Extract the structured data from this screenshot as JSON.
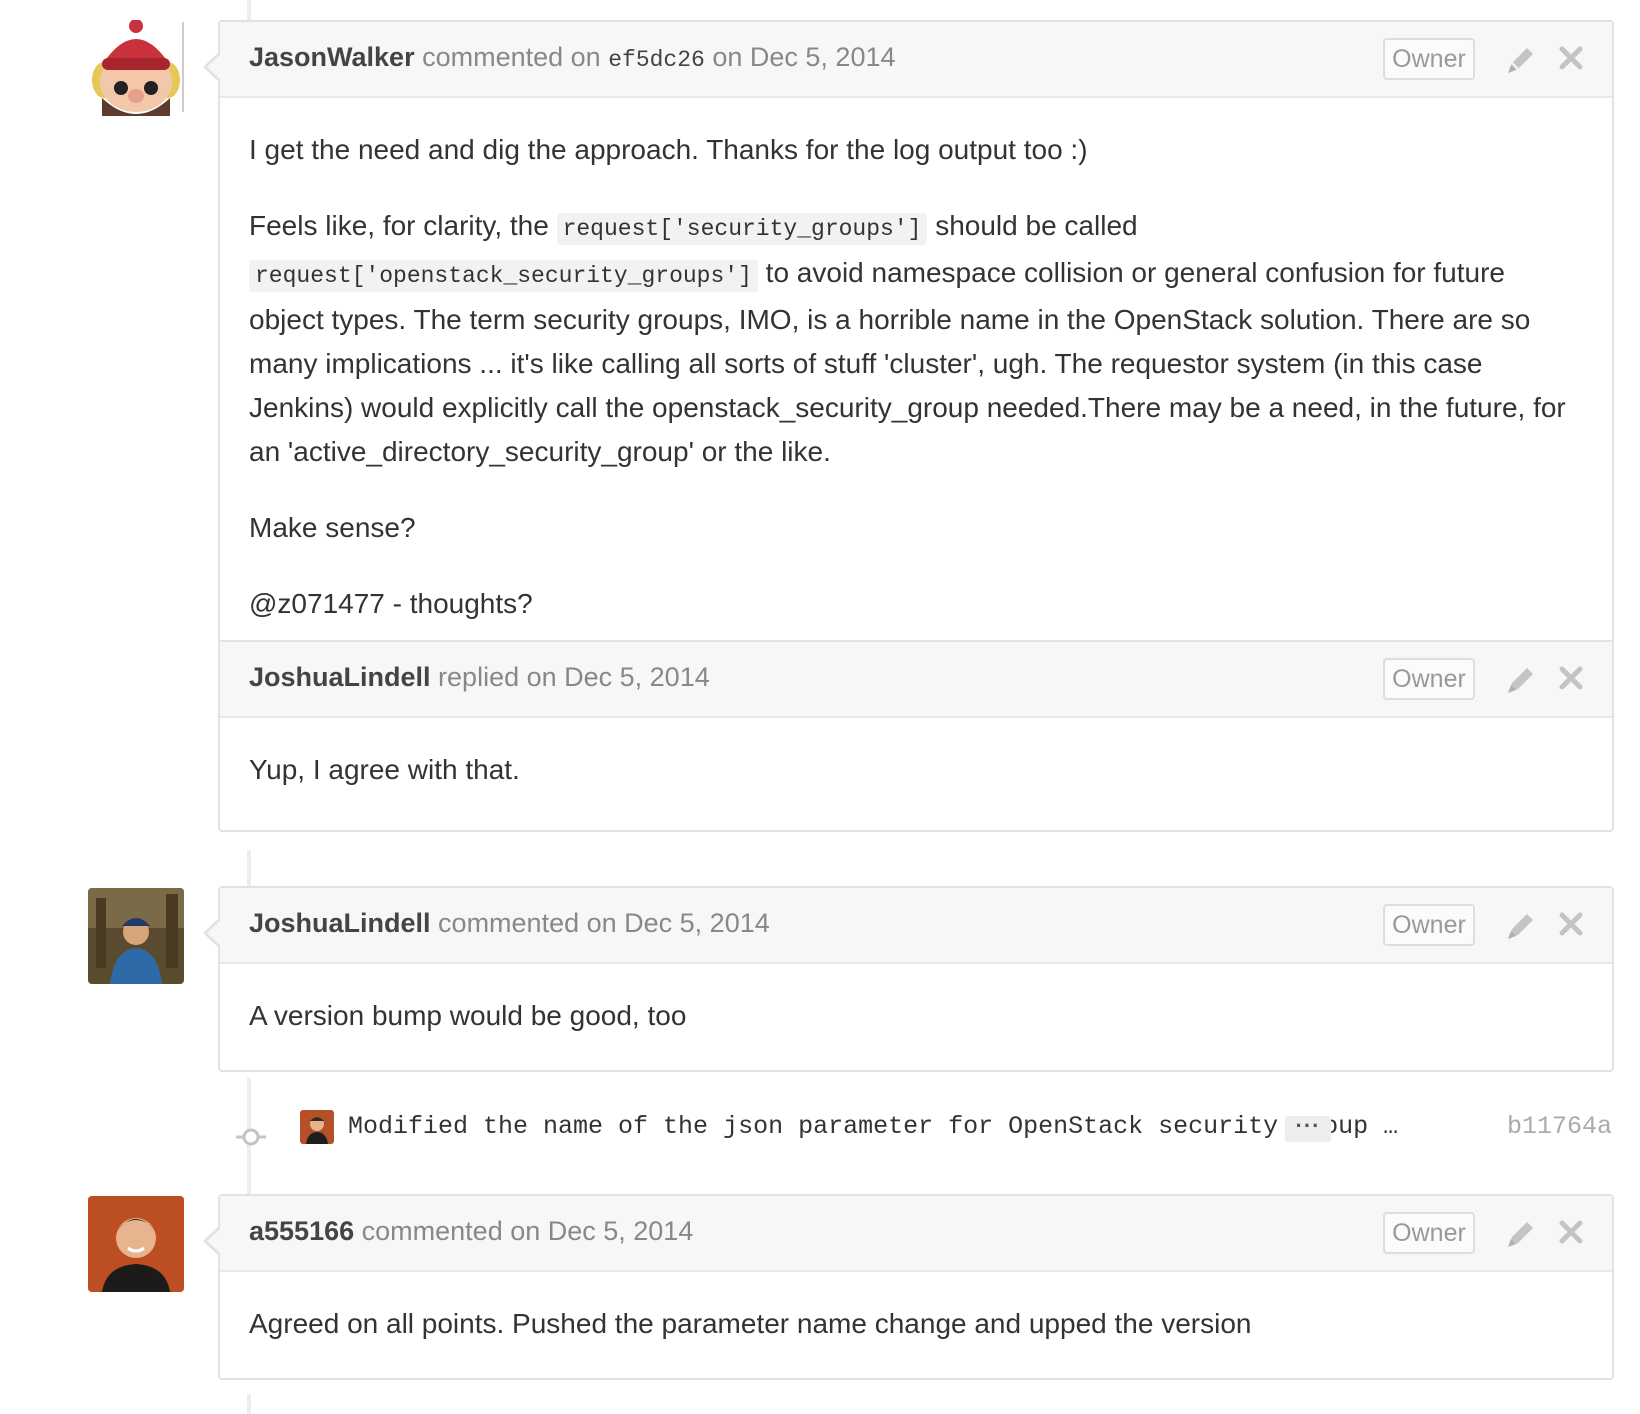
{
  "comments": [
    {
      "author": "JasonWalker",
      "action": "commented on",
      "commit_ref": "ef5dc26",
      "date_text": "on Dec 5, 2014",
      "badge": "Owner",
      "avatar_icon": "yeti-character-icon",
      "paragraphs": {
        "p1": "I get the need and dig the approach. Thanks for the log output too :)",
        "p2_pre": "Feels like, for clarity, the",
        "p2_code1": "request['security_groups']",
        "p2_mid": "should be called",
        "p2_code2": "request['openstack_security_groups']",
        "p2_post": "to avoid namespace collision or general confusion for future object types. The term security groups, IMO, is a horrible name in the OpenStack solution. There are so many implications ... it's like calling all sorts of stuff 'cluster', ugh. The requestor system (in this case Jenkins) would explicitly call the openstack_security_group needed.There may be a need, in the future, for an 'active_directory_security_group' or the like.",
        "p3": "Make sense?",
        "p4": "@z071477 - thoughts?"
      },
      "reply": {
        "author": "JoshuaLindell",
        "action": "replied on Dec 5, 2014",
        "badge": "Owner",
        "body": "Yup, I agree with that."
      }
    },
    {
      "author": "JoshuaLindell",
      "action": "commented on Dec 5, 2014",
      "badge": "Owner",
      "avatar_icon": "user-photo-icon",
      "body": "A version bump would be good, too"
    },
    {
      "author": "a555166",
      "action": "commented on Dec 5, 2014",
      "badge": "Owner",
      "avatar_icon": "user-photo-icon",
      "body": "Agreed on all points. Pushed the parameter name change and upped the version"
    }
  ],
  "commit": {
    "message": "Modified the name of the json parameter for OpenStack security group …",
    "ellipsis": "···",
    "sha": "b11764a"
  },
  "colors": {
    "header_bg": "#f7f7f7",
    "border": "#e2e2e2",
    "author": "#444444",
    "meta": "#888888",
    "icon": "#c4c4c4"
  }
}
